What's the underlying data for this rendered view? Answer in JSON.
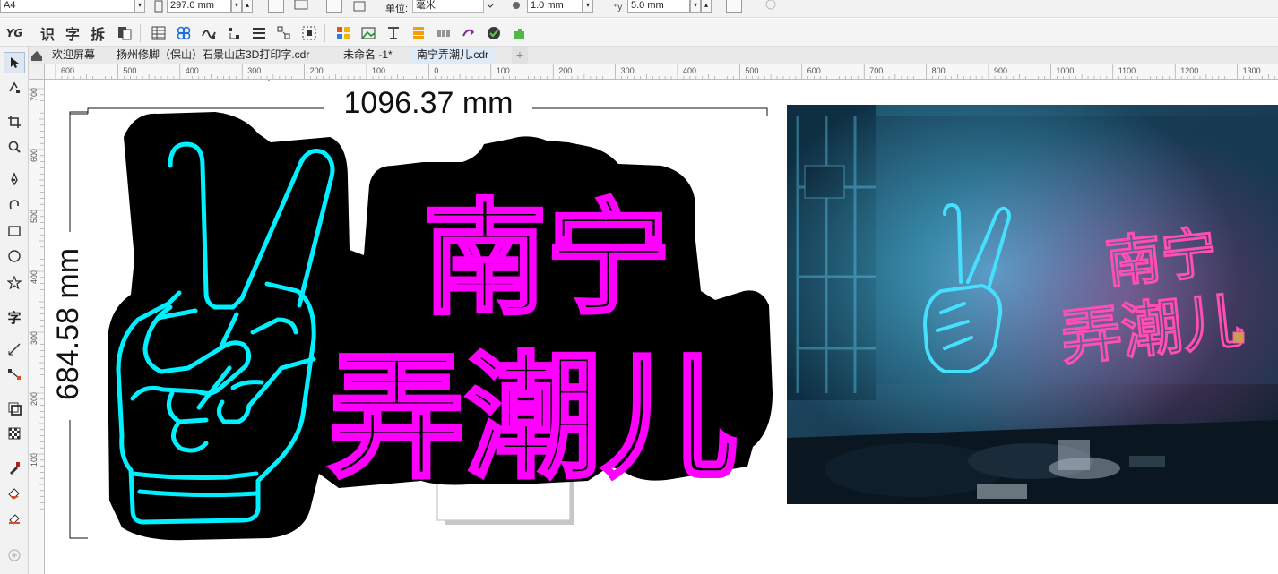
{
  "property_bar": {
    "paper": "A4",
    "height_value": "297.0 mm",
    "units_label": "单位:",
    "units_value": "毫米",
    "nudge_value": "1.0 mm",
    "dup_value": "5.0 mm"
  },
  "toolbar": {
    "logo": "YG",
    "text_tools": [
      "识",
      "字",
      "拆"
    ]
  },
  "tabs": [
    {
      "label": "欢迎屏幕",
      "active": false
    },
    {
      "label": "扬州修脚（保山）石景山店3D打印字.cdr",
      "active": false
    },
    {
      "label": "未命名 -1*",
      "active": false
    },
    {
      "label": "南宁弄潮儿.cdr",
      "active": true
    }
  ],
  "ruler_h": [
    "600",
    "500",
    "400",
    "300",
    "200",
    "100",
    "0",
    "100",
    "200",
    "300",
    "400",
    "500",
    "600",
    "700",
    "800",
    "900",
    "1000",
    "1100",
    "1200",
    "1300"
  ],
  "ruler_v": [
    "700",
    "600",
    "500",
    "400",
    "300",
    "200",
    "100"
  ],
  "toolbox_char": "字",
  "document": {
    "width_dimension": "1096.37 mm",
    "height_dimension": "684.58 mm",
    "sign_line1": "南宁",
    "sign_line2": "弄潮儿",
    "photo_line1": "南宁",
    "photo_line2": "弄潮儿",
    "colors": {
      "backing": "#000000",
      "hand_neon": "#00f0ff",
      "text_neon": "#ff00ff",
      "photo_text": "#ff4fb4",
      "photo_hand": "#39d6ff"
    }
  }
}
